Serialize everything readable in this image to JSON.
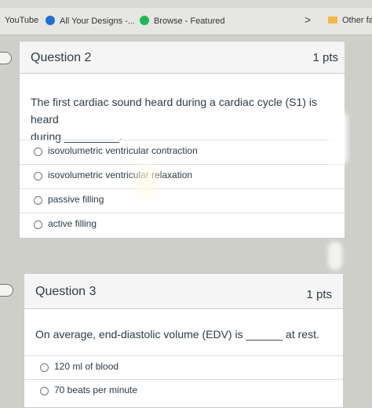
{
  "bookmarks": [
    {
      "label": "YouTube",
      "icon": "youtube-icon"
    },
    {
      "label": "All Your Designs -...",
      "icon": "canva-icon",
      "color": "#1f6fd1"
    },
    {
      "label": "Browse - Featured",
      "icon": "spotify-icon",
      "color": "#1db954"
    },
    {
      "label": "Other fa",
      "icon": "folder-icon",
      "color": "#f5b642"
    }
  ],
  "questions": [
    {
      "title": "Question 2",
      "points": "1 pts",
      "text_line1": "The first cardiac sound heard during a cardiac cycle (S1) is heard",
      "text_line2": "during _________.",
      "answers": [
        "isovolumetric ventricular contraction",
        "isovolumetric ventricular relaxation",
        "passive filling",
        "active filling"
      ]
    },
    {
      "title": "Question 3",
      "points": "1 pts",
      "text_line1": "On average, end-diastolic volume (EDV) is ______ at rest.",
      "answers": [
        "120 ml of blood",
        "70 beats per minute"
      ]
    }
  ]
}
